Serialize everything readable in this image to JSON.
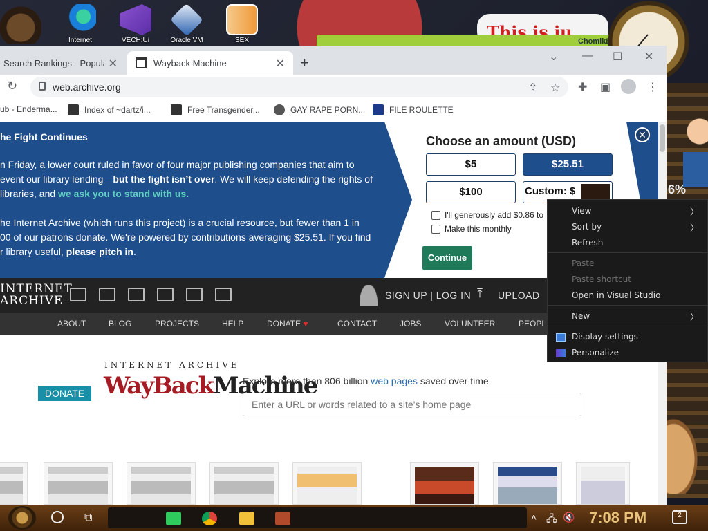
{
  "desktop": {
    "icons": [
      {
        "label": "Internet",
        "icon": "edge-icon"
      },
      {
        "label": "VECH:Ui",
        "icon": "visual-studio-icon"
      },
      {
        "label": "Oracle VM",
        "icon": "virtualbox-icon"
      },
      {
        "label": "SEX",
        "icon": "hxd-icon"
      }
    ],
    "banner_text": "This is ju",
    "popup_title": "ChomikBox",
    "percent_text": "6%"
  },
  "browser": {
    "tabs": [
      {
        "label": "Search Rankings - Popular",
        "active": false
      },
      {
        "label": "Wayback Machine",
        "active": true
      }
    ],
    "url": "web.archive.org",
    "bookmarks": [
      {
        "label": "ub - Enderma..."
      },
      {
        "label": "Index of ~dartz/i..."
      },
      {
        "label": "Free Transgender..."
      },
      {
        "label": "GAY RAPE PORN..."
      },
      {
        "label": "FILE ROULETTE"
      }
    ]
  },
  "donation_banner": {
    "title": "he Fight Continues",
    "para1_a": "n Friday, a lower court ruled in favor of four major publishing companies that aim to",
    "para1_b": "event our library lending—",
    "para1_bold": "but the fight isn’t over",
    "para1_c": ". We will keep defending the rights of",
    "para1_d": " libraries, and ",
    "para1_highlight": "we ask you to stand with us.",
    "para2_a": "he Internet Archive (which runs this project) is a crucial resource, but fewer than 1 in",
    "para2_b": "00 of our patrons donate. We're powered by contributions averaging $25.51. If you find",
    "para2_c": "r library useful, ",
    "para2_bold": "please pitch in",
    "para2_end": ".",
    "amount_title": "Choose an amount (USD)",
    "amounts": [
      "$5",
      "$25.51",
      "$100"
    ],
    "selected_amount": "$25.51",
    "custom_label": "Custom: $",
    "checkbox_fee": "I'll generously add $0.86 to",
    "checkbox_monthly": "Make this monthly",
    "continue_label": "Continue",
    "close_label": "✕"
  },
  "ia_header": {
    "logo_line1": "INTERNET",
    "logo_line2": "ARCHIVE",
    "signup_login": "SIGN UP | LOG IN",
    "upload": "UPLOAD",
    "menu": [
      "ABOUT",
      "BLOG",
      "PROJECTS",
      "HELP",
      "DONATE",
      "CONTACT",
      "JOBS",
      "VOLUNTEER",
      "PEOPL"
    ],
    "donate_heart": "♥"
  },
  "wayback": {
    "donate_label": "DONATE",
    "ia_caption": "INTERNET ARCHIVE",
    "logo_a": "WayBack",
    "logo_b": "Machine",
    "explore_a": "Explore more than 806 billion ",
    "explore_link": "web pages",
    "explore_b": " saved over time",
    "search_placeholder": "Enter a URL or words related to a site's home page"
  },
  "context_menu": {
    "items": [
      {
        "label": "View",
        "submenu": true,
        "disabled": false
      },
      {
        "label": "Sort by",
        "submenu": true,
        "disabled": false
      },
      {
        "label": "Refresh",
        "submenu": false,
        "disabled": false
      },
      {
        "label": "Paste",
        "submenu": false,
        "disabled": true
      },
      {
        "label": "Paste shortcut",
        "submenu": false,
        "disabled": true
      },
      {
        "label": "Open in Visual Studio",
        "submenu": false,
        "disabled": false
      },
      {
        "label": "New",
        "submenu": true,
        "disabled": false
      },
      {
        "label": "Display settings",
        "submenu": false,
        "disabled": false
      },
      {
        "label": "Personalize",
        "submenu": false,
        "disabled": false
      }
    ]
  },
  "taskbar": {
    "time": "7:08 PM",
    "notification_count": "2",
    "apps": [
      "spotify-icon",
      "chrome-icon",
      "file-explorer-icon",
      "game-icon"
    ]
  },
  "colors": {
    "banner_blue": "#1f4e8d",
    "highlight_teal": "#5fd0c1",
    "continue_green": "#1f7a5a",
    "wayback_red": "#a51c24"
  }
}
